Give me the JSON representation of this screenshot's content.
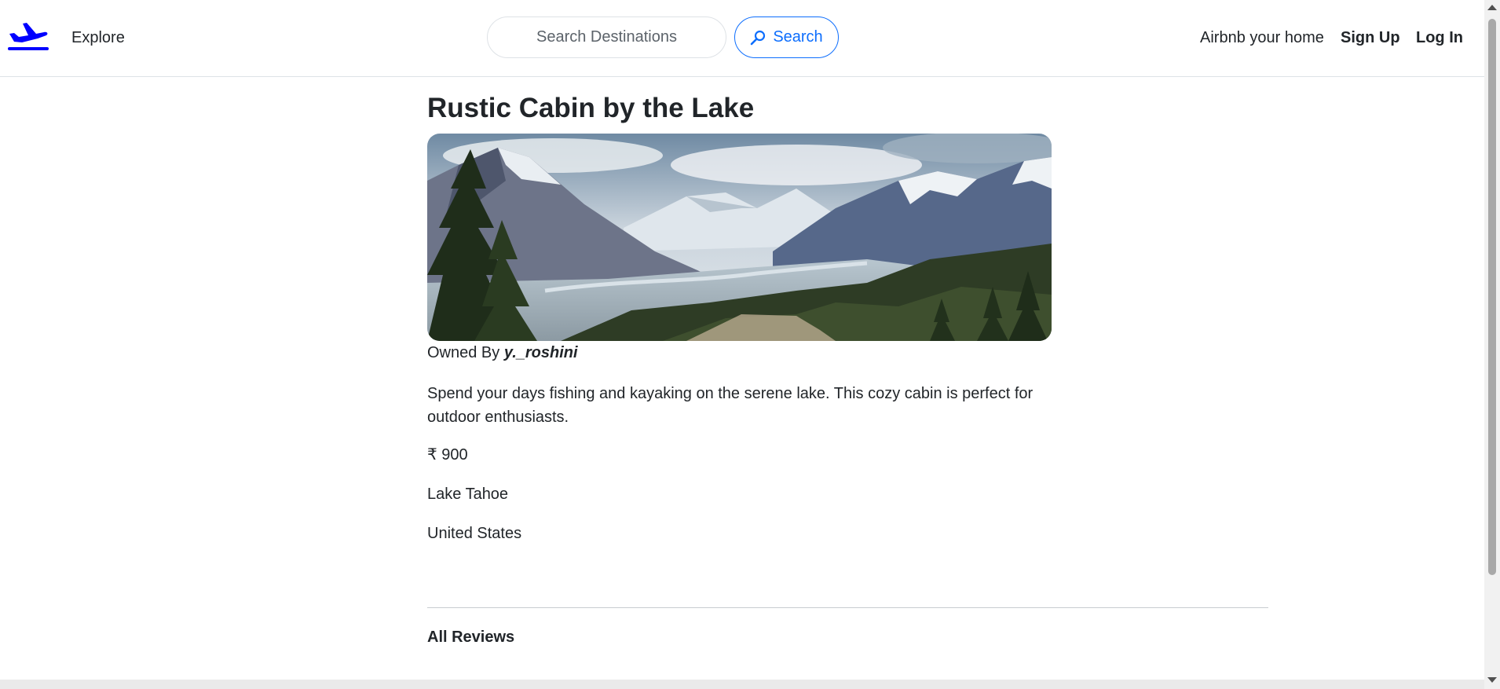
{
  "nav": {
    "brand_icon": "airplane-icon",
    "brand_color": "#0000ff",
    "explore_label": "Explore",
    "search_placeholder": "Search Destinations",
    "search_button_label": "Search",
    "search_icon": "magnifier-icon",
    "host_label": "Airbnb your home",
    "signup_label": "Sign Up",
    "login_label": "Log In"
  },
  "listing": {
    "title": "Rustic Cabin by the Lake",
    "owner_prefix": "Owned By",
    "owner_name": "y._roshini",
    "description": "Spend your days fishing and kayaking on the serene lake. This cozy cabin is perfect for outdoor enthusiasts.",
    "currency_symbol": "₹",
    "price": "900",
    "location": "Lake Tahoe",
    "country": "United States"
  },
  "reviews": {
    "heading": "All Reviews"
  },
  "colors": {
    "accent": "#0d6efd",
    "text": "#212529",
    "border": "#dee2e6"
  }
}
